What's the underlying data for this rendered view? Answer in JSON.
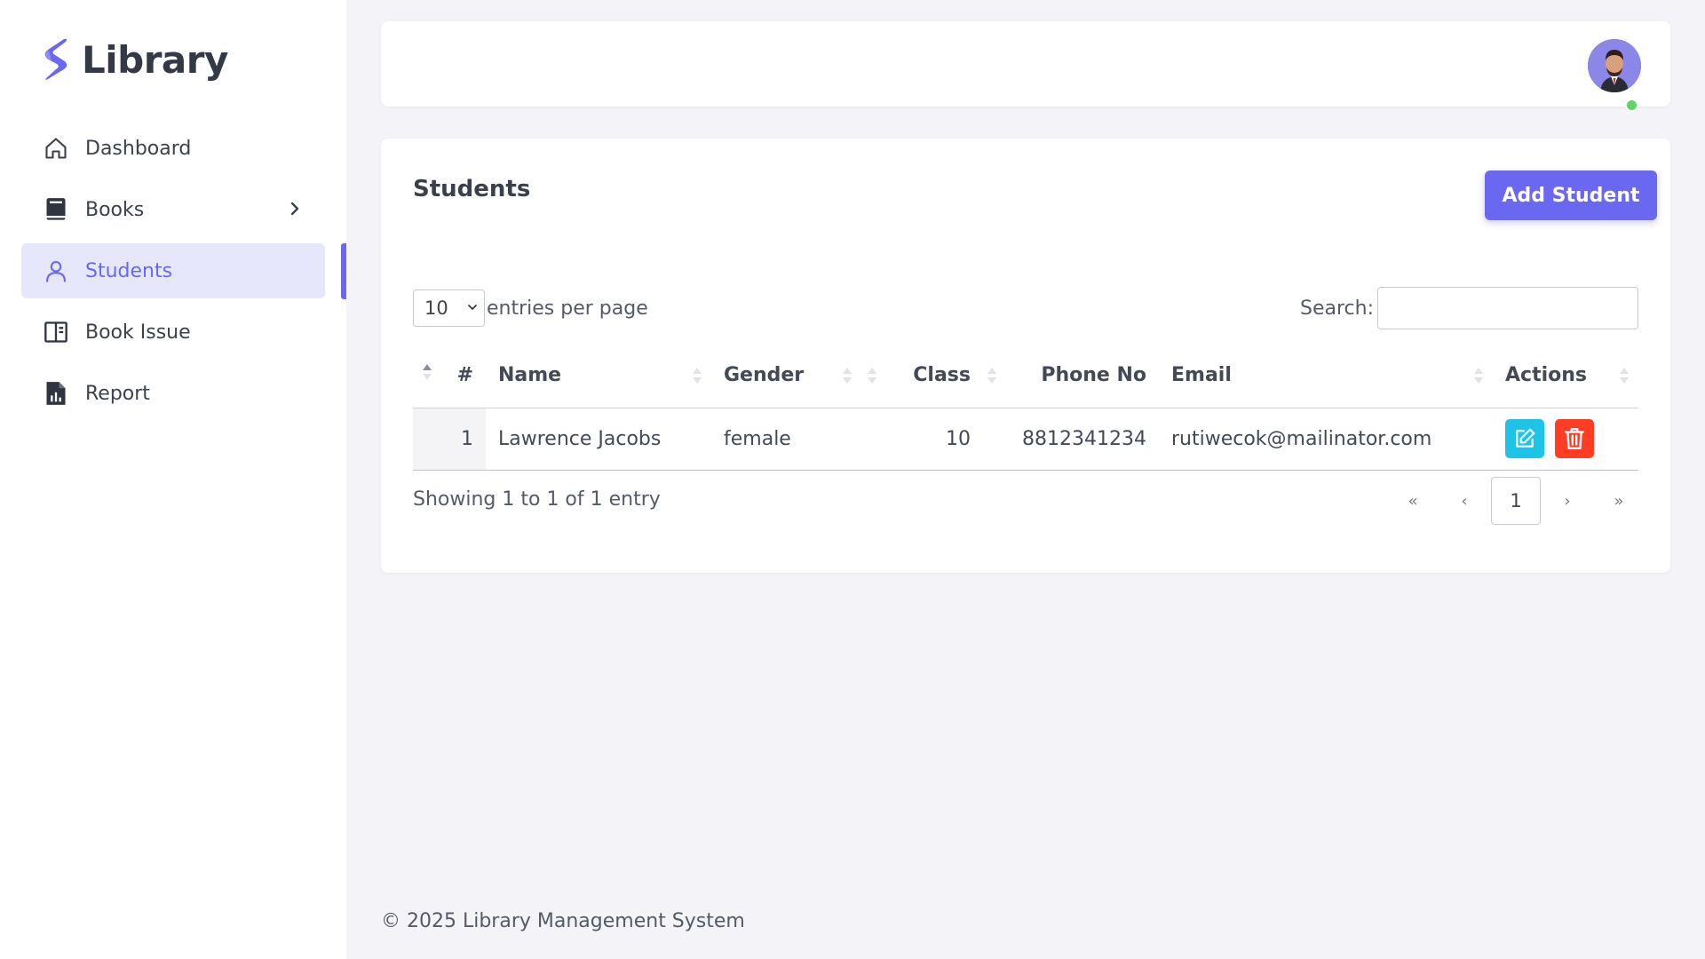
{
  "brand": {
    "name": "Library"
  },
  "sidebar": {
    "items": [
      {
        "label": "Dashboard",
        "icon": "home-icon"
      },
      {
        "label": "Books",
        "icon": "book-icon"
      },
      {
        "label": "Students",
        "icon": "user-icon",
        "active": true
      },
      {
        "label": "Book Issue",
        "icon": "open-book-icon"
      },
      {
        "label": "Report",
        "icon": "report-icon"
      }
    ]
  },
  "card": {
    "title": "Students",
    "add_button": "Add Student",
    "entries_value": "10",
    "entries_label": "entries per page",
    "search_label": "Search:",
    "search_value": ""
  },
  "table": {
    "headers": {
      "num": "#",
      "name": "Name",
      "gender": "Gender",
      "class": "Class",
      "phone": "Phone No",
      "email": "Email",
      "actions": "Actions"
    },
    "rows": [
      {
        "num": "1",
        "name": "Lawrence Jacobs",
        "gender": "female",
        "class": "10",
        "phone": "8812341234",
        "email": "rutiwecok@mailinator.com"
      }
    ]
  },
  "pagination": {
    "info": "Showing 1 to 1 of 1 entry",
    "first": "«",
    "prev": "‹",
    "current": "1",
    "next": "›",
    "last": "»"
  },
  "footer": {
    "text": "© 2025 Library Management System"
  },
  "colors": {
    "accent": "#6a68f0",
    "edit": "#1dc4e8",
    "delete": "#ff3d24",
    "online": "#5fd65f"
  }
}
